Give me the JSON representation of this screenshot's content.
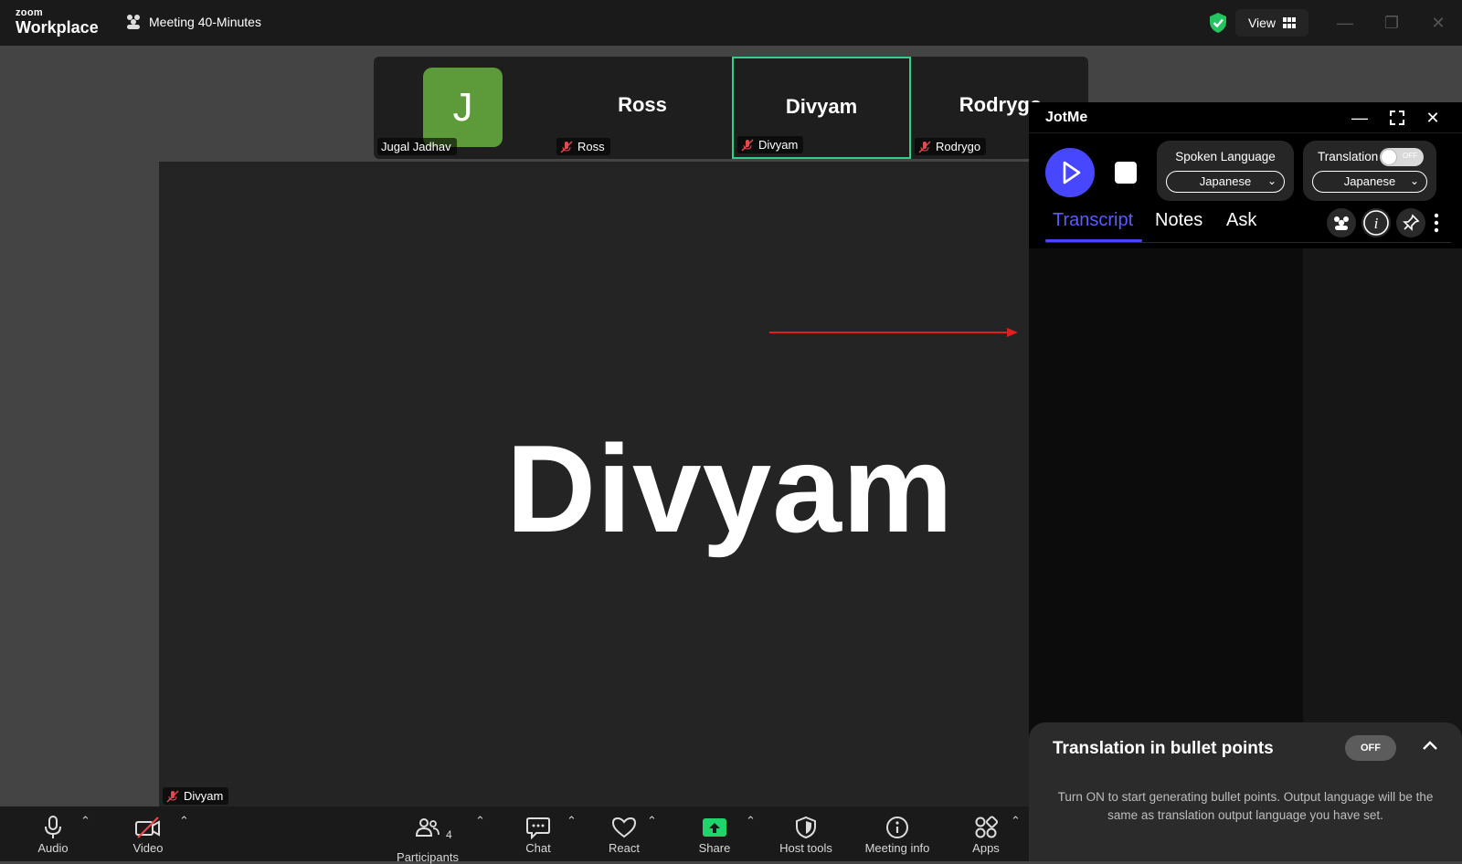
{
  "app": {
    "logo_small": "zoom",
    "logo_big": "Workplace",
    "meeting_title": "Meeting 40-Minutes",
    "view_label": "View"
  },
  "thumbnails": [
    {
      "name": "Jugal Jadhav",
      "avatar_letter": "J",
      "display": ""
    },
    {
      "name": "Ross",
      "display": "Ross"
    },
    {
      "name": "Divyam",
      "display": "Divyam"
    },
    {
      "name": "Rodrygo",
      "display": "Rodrygo"
    }
  ],
  "main": {
    "speaker_name": "Divyam",
    "speaker_tag": "Divyam"
  },
  "toolbar": {
    "audio": "Audio",
    "video": "Video",
    "participants": "Participants",
    "participants_count": "4",
    "chat": "Chat",
    "react": "React",
    "share": "Share",
    "host_tools": "Host tools",
    "meeting_info": "Meeting info",
    "apps": "Apps"
  },
  "jotme": {
    "title": "JotMe",
    "spoken_language_label": "Spoken Language",
    "spoken_language_value": "Japanese",
    "translation_label": "Translation",
    "translation_toggle": "OFF",
    "translation_value": "Japanese",
    "tabs": [
      "Transcript",
      "Notes",
      "Ask"
    ],
    "active_tab": "Transcript"
  },
  "bullet_card": {
    "title": "Translation in bullet points",
    "toggle": "OFF",
    "description": "Turn ON to start generating bullet points. Output language will be the same as translation output language you have set."
  },
  "colors": {
    "accent": "#4747ff",
    "active_speaker_border": "#2fd08b",
    "share_green": "#1fd46a",
    "avatar_green": "#5c9a3a",
    "mute_red": "#e5484d",
    "arrow_red": "#e02020"
  }
}
